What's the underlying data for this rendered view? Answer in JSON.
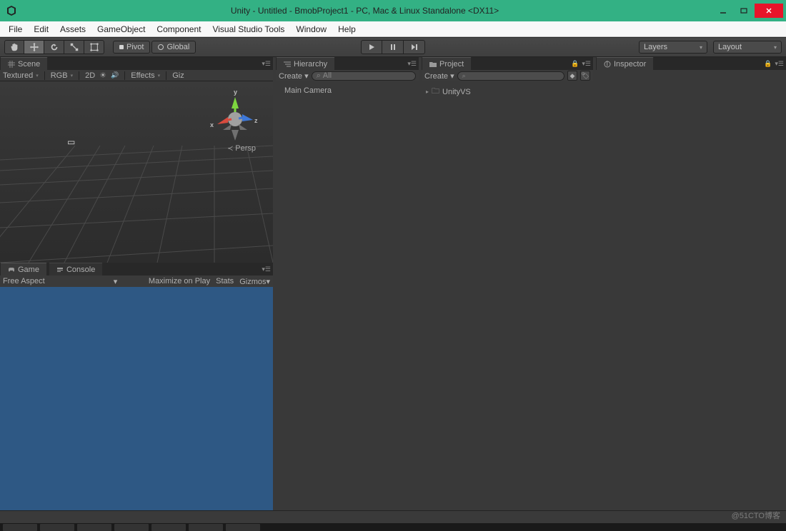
{
  "window": {
    "title": "Unity - Untitled - BmobProject1 - PC, Mac & Linux Standalone <DX11>"
  },
  "menu": {
    "items": [
      "File",
      "Edit",
      "Assets",
      "GameObject",
      "Component",
      "Visual Studio Tools",
      "Window",
      "Help"
    ]
  },
  "toolbar": {
    "pivot_label": "Pivot",
    "global_label": "Global",
    "layers_label": "Layers",
    "layout_label": "Layout"
  },
  "scene": {
    "tab_label": "Scene",
    "shading": "Textured",
    "rgb": "RGB",
    "twod": "2D",
    "effects": "Effects",
    "gizmos": "Giz",
    "axis_x": "x",
    "axis_y": "y",
    "axis_z": "z",
    "perspective": "Persp"
  },
  "game": {
    "tab_label": "Game",
    "console_tab": "Console",
    "aspect": "Free Aspect",
    "maximize": "Maximize on Play",
    "stats": "Stats",
    "gizmos": "Gizmos"
  },
  "hierarchy": {
    "tab_label": "Hierarchy",
    "create_label": "Create",
    "search_placeholder": "All",
    "items": [
      "Main Camera"
    ]
  },
  "project": {
    "tab_label": "Project",
    "create_label": "Create",
    "items": [
      "UnityVS"
    ]
  },
  "inspector": {
    "tab_label": "Inspector"
  },
  "watermark": "@51CTO博客"
}
